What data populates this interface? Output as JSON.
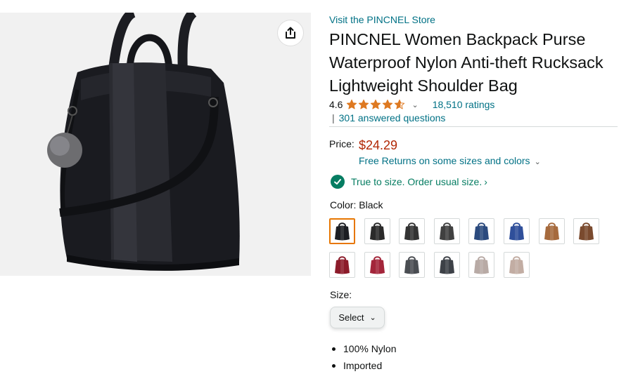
{
  "store": {
    "link_text": "Visit the PINCNEL Store"
  },
  "product": {
    "title": "PINCNEL Women Backpack Purse Waterproof Nylon Anti-theft Rucksack Lightweight Shoulder Bag",
    "rating": 4.6,
    "rating_text": "4.6",
    "ratings_count_text": "18,510 ratings",
    "qa_separator": "|",
    "answered_questions_text": "301 answered questions",
    "price_label": "Price:",
    "price": "$24.29",
    "free_returns_text": "Free Returns on some sizes and colors",
    "fit_text": "True to size. Order usual size.",
    "fit_chevron": "›",
    "color_label": "Color:",
    "color_value": "Black",
    "colors": [
      {
        "name": "black",
        "color": "#1b1d22"
      },
      {
        "name": "black-2",
        "color": "#2a2a2a"
      },
      {
        "name": "black-gray",
        "color": "#333333"
      },
      {
        "name": "black-floral",
        "color": "#404040"
      },
      {
        "name": "navy",
        "color": "#2b4a7e"
      },
      {
        "name": "blue",
        "color": "#2f4f9a"
      },
      {
        "name": "tan",
        "color": "#a66a3d"
      },
      {
        "name": "brown",
        "color": "#7a4a2e"
      },
      {
        "name": "red",
        "color": "#8c1b2a"
      },
      {
        "name": "wine",
        "color": "#a3253a"
      },
      {
        "name": "gray",
        "color": "#4a4d52"
      },
      {
        "name": "dark-gray",
        "color": "#3d4147"
      },
      {
        "name": "light-gray",
        "color": "#b8aaa5"
      },
      {
        "name": "beige",
        "color": "#c2ada3"
      }
    ],
    "selected_color_index": 0,
    "size_label": "Size:",
    "size_select_value": "Select",
    "bullets": [
      "100% Nylon",
      "Imported"
    ]
  },
  "colors": {
    "link": "#007185",
    "price": "#b12704",
    "success": "#067d62",
    "star": "#de7921",
    "selected_border": "#e77600"
  },
  "icons": {
    "share": "share-icon",
    "check": "check-circle-icon",
    "chevron": "chevron-down-icon",
    "star": "star-icon"
  }
}
